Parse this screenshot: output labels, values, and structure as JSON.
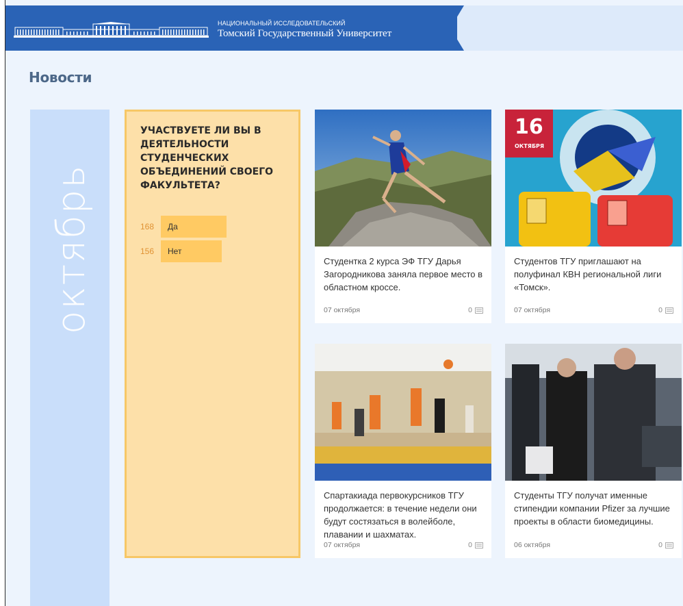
{
  "header": {
    "uni_small": "НАЦИОНАЛЬНЫЙ ИССЛЕДОВАТЕЛЬСКИЙ",
    "uni_big": "Томский Государственный Университет",
    "brand_color": "#2a63b6"
  },
  "page": {
    "title": "Новости"
  },
  "month": {
    "label": "октябрь"
  },
  "poll": {
    "question": "УЧАСТВУЕТЕ ЛИ ВЫ В ДЕЯТЕЛЬНОСТИ СТУДЕНЧЕСКИХ ОБЪЕДИНЕНИЙ СВОЕГО ФАКУЛЬТЕТА?",
    "options": [
      {
        "count": "168",
        "label": "Да",
        "share": 0.52
      },
      {
        "count": "156",
        "label": "Нет",
        "share": 0.48
      }
    ]
  },
  "news": [
    {
      "text": "Студентка 2 курса ЭФ ТГУ Дарья Загородникова заняла первое место в областном кроссе.",
      "date": "07 октября",
      "comments": "0"
    },
    {
      "text": "Студентов ТГУ приглашают на полуфинал КВН региональной лиги «Томск».",
      "date": "07 октября",
      "comments": "0",
      "badge_day": "16",
      "badge_month": "ОКТЯБРЯ"
    },
    {
      "text": "Спартакиада первокурсников ТГУ продолжается: в течение недели они будут состязаться в волейболе, плавании и шахматах.",
      "date": "07 октября",
      "comments": "0"
    },
    {
      "text": "Студенты ТГУ получат именные стипендии компании Pfizer за лучшие проекты в области биомедицины.",
      "date": "06 октября",
      "comments": "0"
    }
  ],
  "icons": {
    "comment": "comment-icon"
  }
}
